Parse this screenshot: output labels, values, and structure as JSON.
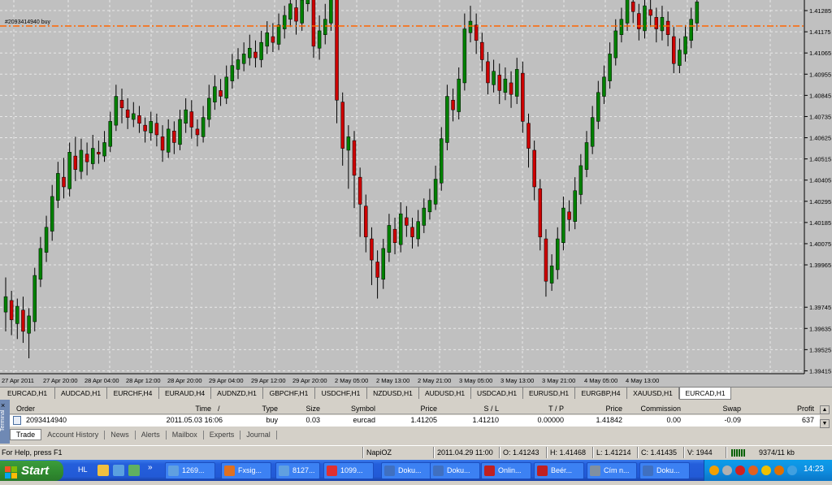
{
  "chart": {
    "symbol_tab": "EURCAD,H1",
    "order_label": "#2093414940 buy",
    "order_line_price": 1.41205,
    "order_line_color": "#ff6600",
    "bull_color": "#008000",
    "bear_color": "#cc0000",
    "price_axis": [
      "1.41285",
      "1.41175",
      "1.41065",
      "1.40955",
      "1.40845",
      "1.40735",
      "1.40625",
      "1.40515",
      "1.40405",
      "1.40295",
      "1.40185",
      "1.40075",
      "1.39965",
      "1.39745",
      "1.39635",
      "1.39525",
      "1.39415"
    ],
    "time_axis": [
      "27 Apr 2011",
      "27 Apr 20:00",
      "28 Apr 04:00",
      "28 Apr 12:00",
      "28 Apr 20:00",
      "29 Apr 04:00",
      "29 Apr 12:00",
      "29 Apr 20:00",
      "2 May 05:00",
      "2 May 13:00",
      "2 May 21:00",
      "3 May 05:00",
      "3 May 13:00",
      "3 May 21:00",
      "4 May 05:00",
      "4 May 13:00"
    ]
  },
  "chart_tabs": [
    "EURCAD,H1",
    "AUDCAD,H1",
    "EURCHF,H4",
    "EURAUD,H4",
    "AUDNZD,H1",
    "GBPCHF,H1",
    "USDCHF,H1",
    "NZDUSD,H1",
    "AUDUSD,H1",
    "USDCAD,H1",
    "EURUSD,H1",
    "EURGBP,H4",
    "XAUUSD,H1",
    "EURCAD,H1"
  ],
  "terminal": {
    "side_label": "Terminal",
    "close_icon": "×",
    "headers": {
      "order": "Order",
      "time": "Time",
      "sort": "/",
      "type": "Type",
      "size": "Size",
      "symbol": "Symbol",
      "price": "Price",
      "sl": "S / L",
      "tp": "T / P",
      "price2": "Price",
      "commission": "Commission",
      "swap": "Swap",
      "profit": "Profit"
    },
    "row": {
      "order": "2093414940",
      "time": "2011.05.03 16:06",
      "type": "buy",
      "size": "0.03",
      "symbol": "eurcad",
      "price": "1.41205",
      "sl": "1.41210",
      "tp": "0.00000",
      "price2": "1.41842",
      "commission": "0.00",
      "swap": "-0.09",
      "profit": "637"
    },
    "tabs": [
      "Trade",
      "Account History",
      "News",
      "Alerts",
      "Mailbox",
      "Experts",
      "Journal"
    ]
  },
  "status": {
    "help": "For Help, press F1",
    "profile": "NapiOZ",
    "datetime": "2011.04.29 11:00",
    "open": "O: 1.41243",
    "high": "H: 1.41468",
    "low": "L: 1.41214",
    "close": "C: 1.41435",
    "volume": "V: 1944",
    "traffic": "9374/11 kb"
  },
  "taskbar": {
    "start": "Start",
    "lang": "HL",
    "chevron": "»",
    "tasks": [
      "1269...",
      "Fxsig...",
      "8127...",
      "1099...",
      "Doku...",
      "Doku...",
      "Onlin...",
      "Beér...",
      "Cím n...",
      "Doku..."
    ],
    "clock": "14:23"
  }
}
